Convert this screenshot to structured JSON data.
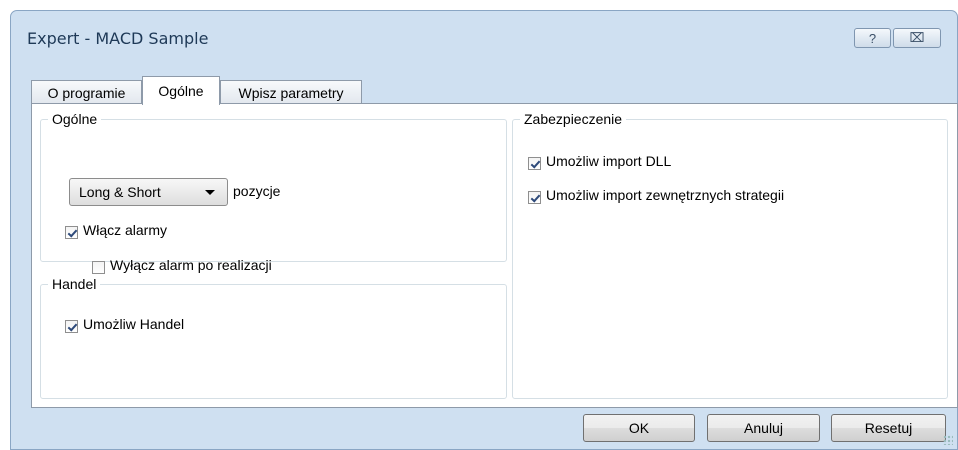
{
  "window": {
    "title": "Expert - MACD Sample",
    "help_icon": "?",
    "close_icon": "⌧"
  },
  "tabs": [
    {
      "label": "O programie",
      "active": false
    },
    {
      "label": "Ogólne",
      "active": true
    },
    {
      "label": "Wpisz parametry",
      "active": false
    }
  ],
  "general": {
    "title": "Ogólne",
    "positions": {
      "selected": "Long & Short",
      "suffix": "pozycje"
    },
    "enable_alerts": {
      "label": "Włącz alarmy",
      "checked": true
    },
    "disable_alert_after": {
      "label": "Wyłącz alarm po realizacji",
      "checked": false
    }
  },
  "trade": {
    "title": "Handel",
    "allow_trade": {
      "label": "Umożliw Handel",
      "checked": true
    }
  },
  "safety": {
    "title": "Zabezpieczenie",
    "allow_dll": {
      "label": "Umożliw import DLL",
      "checked": true
    },
    "allow_external": {
      "label": "Umożliw import zewnętrznych strategii",
      "checked": true
    }
  },
  "buttons": {
    "ok": "OK",
    "cancel": "Anuluj",
    "reset": "Resetuj"
  }
}
